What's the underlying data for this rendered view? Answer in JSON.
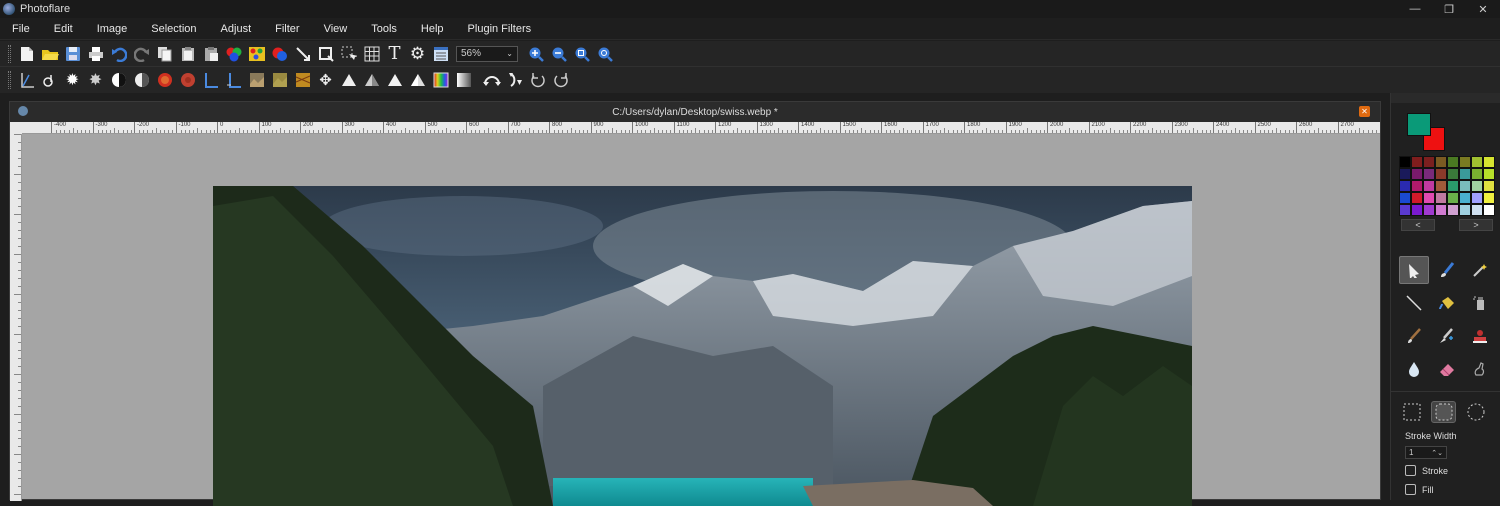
{
  "app": {
    "title": "Photoflare"
  },
  "window_controls": [
    "—",
    "❐",
    "✕"
  ],
  "menu": [
    "File",
    "Edit",
    "Image",
    "Selection",
    "Adjust",
    "Filter",
    "View",
    "Tools",
    "Help",
    "Plugin Filters"
  ],
  "toolbar1": {
    "icons": [
      "new-file-icon",
      "open-folder-icon",
      "save-icon",
      "print-icon",
      "undo-icon",
      "redo-icon",
      "copy-icon",
      "paste-icon",
      "paste-alt-icon",
      "color-balance-icon",
      "palette-icon",
      "hue-icon",
      "crop-line-icon",
      "resize-image-icon",
      "resize-canvas-icon",
      "grid-icon",
      "text-icon",
      "settings-icon",
      "properties-icon"
    ],
    "zoom_value": "56%",
    "zoom_icons": [
      "zoom-in-icon",
      "zoom-out-icon",
      "zoom-fit-icon",
      "zoom-actual-icon"
    ]
  },
  "toolbar2": {
    "icons": [
      "levels-icon",
      "curves-icon",
      "brightness-up-icon",
      "brightness-down-icon",
      "contrast-up-icon",
      "contrast-down-icon",
      "saturation-up-icon",
      "saturation-down-icon",
      "gamma-up-icon",
      "gamma-down-icon",
      "sepia-icon",
      "emboss-icon",
      "solarize-icon",
      "move-icon",
      "sharpen-icon",
      "sharpen-more-icon",
      "blur-icon",
      "blur-more-icon",
      "gradient-icon",
      "grayscale-icon",
      "flip-horizontal-icon",
      "flip-vertical-icon",
      "rotate-ccw-icon",
      "rotate-cw-icon"
    ]
  },
  "document": {
    "title": "C:/Users/dylan/Desktop/swiss.webp *",
    "ruler_labels": [
      "-400",
      "-300",
      "-200",
      "-100",
      "0",
      "100",
      "200",
      "300",
      "400",
      "500",
      "600",
      "700",
      "800",
      "900",
      "1000",
      "1100",
      "1200",
      "1300",
      "1400",
      "1500",
      "1600",
      "1700",
      "1800",
      "1900",
      "2000",
      "2100",
      "2200",
      "2300",
      "2400",
      "2500",
      "2600",
      "2700"
    ]
  },
  "colors": {
    "primary": "#0a9a78",
    "secondary": "#ee1111",
    "palette": [
      "#000000",
      "#7f1d1d",
      "#7a1f1f",
      "#7b5a22",
      "#4a7a22",
      "#7a7a22",
      "#a0c030",
      "#d6e430",
      "#1a1a5a",
      "#7a1a6a",
      "#7a2a7a",
      "#8a3a2a",
      "#3a7a3a",
      "#3a9a9a",
      "#7ab030",
      "#b6e02a",
      "#2a2ab0",
      "#b01a6a",
      "#c03aa0",
      "#a05a3a",
      "#2a9a6a",
      "#7abcbc",
      "#a0d0a0",
      "#e0e040",
      "#1a4ad0",
      "#d01a2a",
      "#e04ab0",
      "#c07aa0",
      "#6ab04a",
      "#4ab0d0",
      "#a0a0ff",
      "#f0f040",
      "#5a3ad0",
      "#7a1ad0",
      "#a03ad0",
      "#d07ad0",
      "#d0a0d0",
      "#a0d0e0",
      "#d0e0f0",
      "#ffffff"
    ],
    "prev_label": "<",
    "next_label": ">"
  },
  "tools": [
    "pointer-icon",
    "paint-brush-icon",
    "magic-wand-icon",
    "line-icon",
    "paint-bucket-icon",
    "spray-can-icon",
    "paintbrush-icon",
    "clone-stamp-icon",
    "stamp-icon",
    "blur-drop-icon",
    "eraser-icon",
    "smudge-icon"
  ],
  "selection_shapes": [
    "rect-select-icon",
    "rounded-rect-select-icon",
    "ellipse-select-icon"
  ],
  "stroke": {
    "label": "Stroke Width",
    "value": "1",
    "stroke_label": "Stroke",
    "fill_label": "Fill"
  }
}
